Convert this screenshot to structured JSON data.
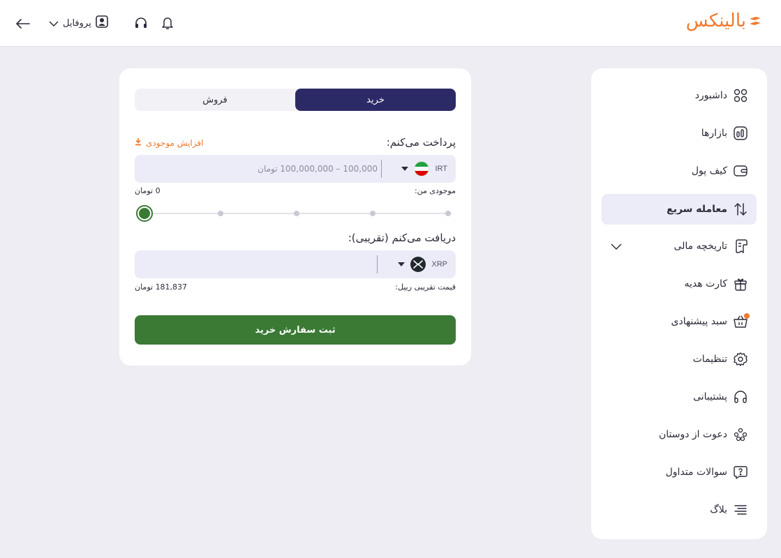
{
  "header": {
    "logo_text": "بالینکس",
    "profile_label": "پروفایل"
  },
  "sidebar": {
    "items": [
      {
        "label": "داشبورد",
        "icon": "grid-icon"
      },
      {
        "label": "بازارها",
        "icon": "chart-bars-icon"
      },
      {
        "label": "کیف پول",
        "icon": "wallet-icon"
      },
      {
        "label": "معامله سریع",
        "icon": "swap-arrows-icon",
        "active": true
      },
      {
        "label": "تاریخچه مالی",
        "icon": "receipt-icon",
        "expandable": true
      },
      {
        "label": "کارت هدیه",
        "icon": "gift-icon"
      },
      {
        "label": "سبد پیشنهادی",
        "icon": "basket-icon",
        "badge": true
      },
      {
        "label": "تنظیمات",
        "icon": "gear-icon"
      },
      {
        "label": "پشتیبانی",
        "icon": "headset-icon"
      },
      {
        "label": "دعوت از دوستان",
        "icon": "people-icon"
      },
      {
        "label": "سوالات متداول",
        "icon": "question-icon"
      },
      {
        "label": "بلاگ",
        "icon": "text-lines-icon"
      }
    ]
  },
  "trade": {
    "tab_buy": "خرید",
    "tab_sell": "فروش",
    "pay_label": "پرداخت می‌کنم:",
    "add_balance": "افزایش موجودی",
    "pay_currency": "IRT",
    "pay_placeholder": "100,000 – 100,000,000 تومان",
    "balance_label": "موجودی من:",
    "balance_value": "0 تومان",
    "slider_level_percent": 0,
    "receive_label": "دریافت می‌کنم (تقریبی):",
    "receive_currency": "XRP",
    "price_label": "قیمت تقریبی ریپل:",
    "price_value": "181,837 تومان",
    "submit_label": "ثبت سفارش خرید"
  },
  "colors": {
    "brand_orange": "#f0792f",
    "buy_tab": "#2c2a66",
    "submit_green": "#3a7a35",
    "active_nav_bg": "#ececf8"
  }
}
